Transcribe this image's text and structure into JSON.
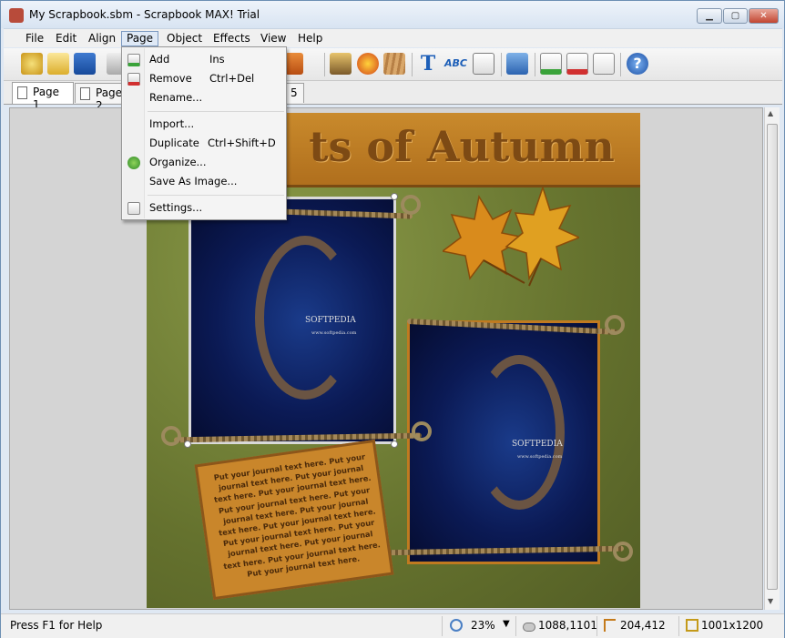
{
  "window": {
    "title": "My Scrapbook.sbm - Scrapbook MAX! Trial",
    "min_label": "▁",
    "max_label": "▢",
    "close_label": "✕"
  },
  "menubar": [
    "File",
    "Edit",
    "Align",
    "Page",
    "Object",
    "Effects",
    "View",
    "Help"
  ],
  "toolbar_icons": [
    "wizard-icon",
    "open-folder-icon",
    "save-icon",
    "print-icon",
    "arrange-icon",
    "image-icon",
    "embellishment-icon",
    "paper-icon",
    "text-icon",
    "spellcheck-icon",
    "journal-icon",
    "shape-icon",
    "add-page-icon",
    "remove-page-icon",
    "page-settings-icon",
    "help-icon"
  ],
  "tabs": [
    {
      "label": "Page 1",
      "selected": true
    },
    {
      "label": "Page 2",
      "selected": false
    },
    {
      "label": "5",
      "selected": false
    }
  ],
  "page_menu": {
    "items": [
      {
        "label": "Add",
        "shortcut": "Ins",
        "icon": "add-page-icon"
      },
      {
        "label": "Remove",
        "shortcut": "Ctrl+Del",
        "icon": "remove-page-icon"
      },
      {
        "label": "Rename...",
        "shortcut": "",
        "icon": ""
      },
      {
        "label": "Import...",
        "shortcut": "",
        "icon": ""
      },
      {
        "label": "Duplicate",
        "shortcut": "Ctrl+Shift+D",
        "icon": ""
      },
      {
        "label": "Organize...",
        "shortcut": "",
        "icon": "organize-icon"
      },
      {
        "label": "Save As Image...",
        "shortcut": "",
        "icon": ""
      },
      {
        "label": "Settings...",
        "shortcut": "",
        "icon": "settings-icon"
      }
    ]
  },
  "scrapbook": {
    "banner_text": "ts of Autumn",
    "watermark": "SOFTPEDIA",
    "watermark_url": "www.softpedia.com",
    "journal_text": "Put your journal text here. Put your journal text here. Put your journal text here. Put your journal text here. Put your journal text here. Put your journal text here. Put your journal text here. Put your journal text here. Put your journal text here. Put your journal text here. Put your journal text here. Put your journal text here. Put your journal text here."
  },
  "status": {
    "help": "Press F1 for Help",
    "zoom": "23%",
    "cursor": "1088,1101",
    "position": "204,412",
    "size": "1001x1200"
  },
  "colors": {
    "banner": "#b8772a",
    "background_green": "#6b7a34",
    "photo_blue": "#0b1a55",
    "tag": "#c9862b"
  }
}
